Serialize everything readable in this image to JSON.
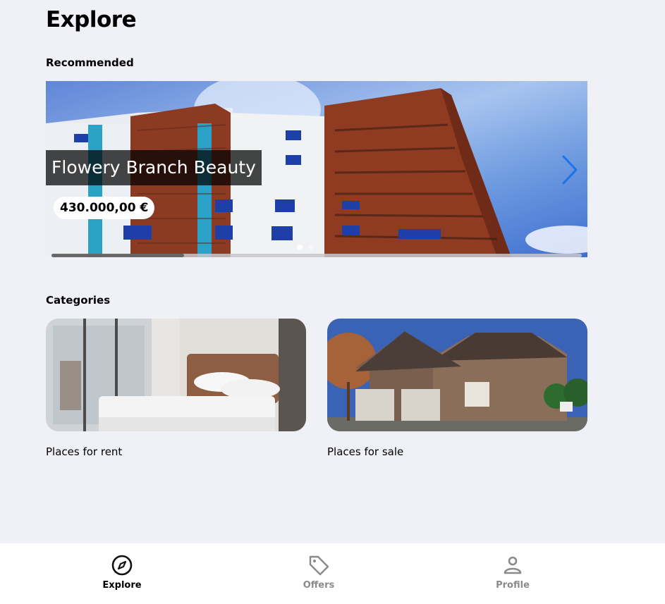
{
  "page": {
    "title": "Explore"
  },
  "recommended": {
    "section_title": "Recommended",
    "slide": {
      "title": "Flowery Branch Beauty",
      "price": "430.000,00 €"
    },
    "dots_total": 2,
    "active_dot": 1
  },
  "categories": {
    "section_title": "Categories",
    "items": [
      {
        "label": "Places for rent"
      },
      {
        "label": "Places for sale"
      }
    ]
  },
  "bottom_nav": {
    "items": [
      {
        "label": "Explore",
        "icon": "compass-icon",
        "active": true
      },
      {
        "label": "Offers",
        "icon": "tag-icon",
        "active": false
      },
      {
        "label": "Profile",
        "icon": "person-icon",
        "active": false
      }
    ]
  },
  "colors": {
    "background": "#f0f1f7",
    "accent": "#1a73e8",
    "inactive": "#8a8a8a"
  }
}
